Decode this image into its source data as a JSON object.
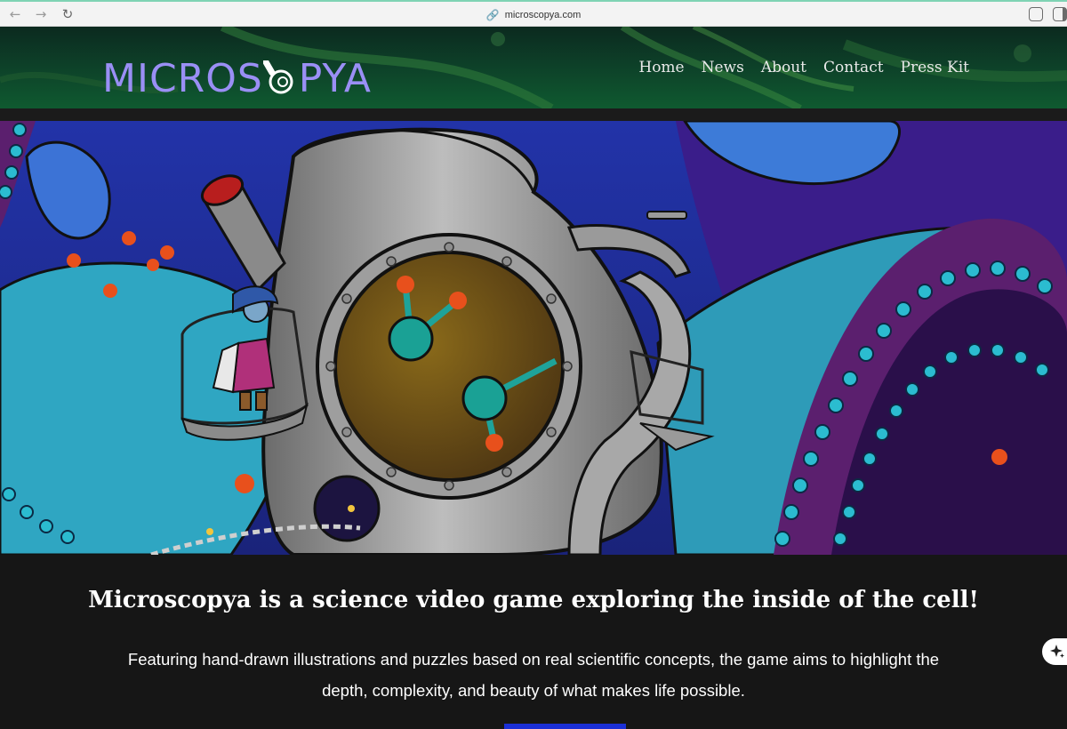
{
  "browser": {
    "url": "microscopya.com",
    "back_icon": "arrow-left-icon",
    "forward_icon": "arrow-right-icon",
    "reload_icon": "reload-icon"
  },
  "header": {
    "logo_text_left": "MICROS",
    "logo_text_right": "PYA",
    "nav": [
      "Home",
      "News",
      "About",
      "Contact",
      "Press Kit"
    ]
  },
  "hero": {
    "image": "illustration of a microscope-shaped vessel with a girl on a balcony inside a cell"
  },
  "main": {
    "tagline": "Microscopya is a science video game exploring the inside of the cell!",
    "description": "Featuring hand-drawn illustrations and puzzles based on real scientific concepts, the game aims to highlight the depth, complexity, and beauty of what makes life possible."
  },
  "colors": {
    "logo": "#9a8ff5",
    "page_background": "#161616",
    "accent_bar": "#1b2fd6"
  }
}
